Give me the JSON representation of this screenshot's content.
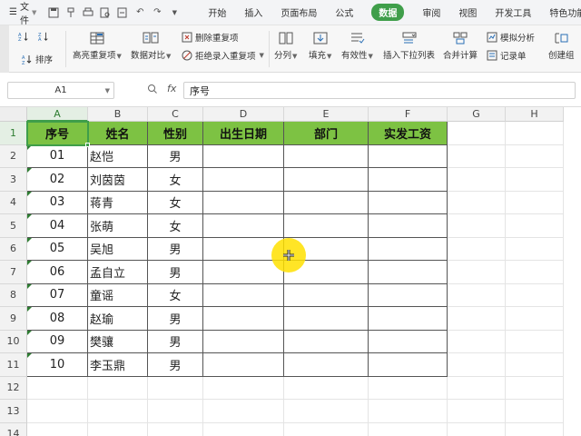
{
  "menu": {
    "label": "文件"
  },
  "tabs": [
    {
      "label": "开始",
      "active": false
    },
    {
      "label": "插入",
      "active": false
    },
    {
      "label": "页面布局",
      "active": false
    },
    {
      "label": "公式",
      "active": false
    },
    {
      "label": "数据",
      "active": true
    },
    {
      "label": "审阅",
      "active": false
    },
    {
      "label": "视图",
      "active": false
    },
    {
      "label": "开发工具",
      "active": false
    },
    {
      "label": "特色功能",
      "active": false
    }
  ],
  "ribbon": {
    "sort_label": "排序",
    "highlight_dup_label": "高亮重复项",
    "compare_label": "数据对比",
    "delete_dup_label": "删除重复项",
    "reject_dup_label": "拒绝录入重复项",
    "split_label": "分列",
    "fill_label": "填充",
    "validity_label": "有效性",
    "dropdown_list_label": "插入下拉列表",
    "consolidate_label": "合并计算",
    "what_if_label": "模拟分析",
    "record_label": "记录单",
    "create_group_label": "创建组"
  },
  "formula_bar": {
    "cell_ref": "A1",
    "fx": "fx",
    "content": "序号"
  },
  "columns": [
    "A",
    "B",
    "C",
    "D",
    "E",
    "F",
    "G",
    "H"
  ],
  "rows": [
    "1",
    "2",
    "3",
    "4",
    "5",
    "6",
    "7",
    "8",
    "9",
    "10",
    "11",
    "12",
    "13",
    "14"
  ],
  "table": {
    "headers": [
      "序号",
      "姓名",
      "性别",
      "出生日期",
      "部门",
      "实发工资"
    ],
    "rows": [
      [
        "01",
        "赵恺",
        "男",
        "",
        "",
        ""
      ],
      [
        "02",
        "刘茵茵",
        "女",
        "",
        "",
        ""
      ],
      [
        "03",
        "蒋青",
        "女",
        "",
        "",
        ""
      ],
      [
        "04",
        "张萌",
        "女",
        "",
        "",
        ""
      ],
      [
        "05",
        "吴旭",
        "男",
        "",
        "",
        ""
      ],
      [
        "06",
        "孟自立",
        "男",
        "",
        "",
        ""
      ],
      [
        "07",
        "童谣",
        "女",
        "",
        "",
        ""
      ],
      [
        "08",
        "赵瑜",
        "男",
        "",
        "",
        ""
      ],
      [
        "09",
        "樊骧",
        "男",
        "",
        "",
        ""
      ],
      [
        "10",
        "李玉鼎",
        "男",
        "",
        "",
        ""
      ]
    ]
  },
  "colors": {
    "accent": "#3f9e4a",
    "header_fill": "#7dc243",
    "cursor": "#ffe000"
  }
}
